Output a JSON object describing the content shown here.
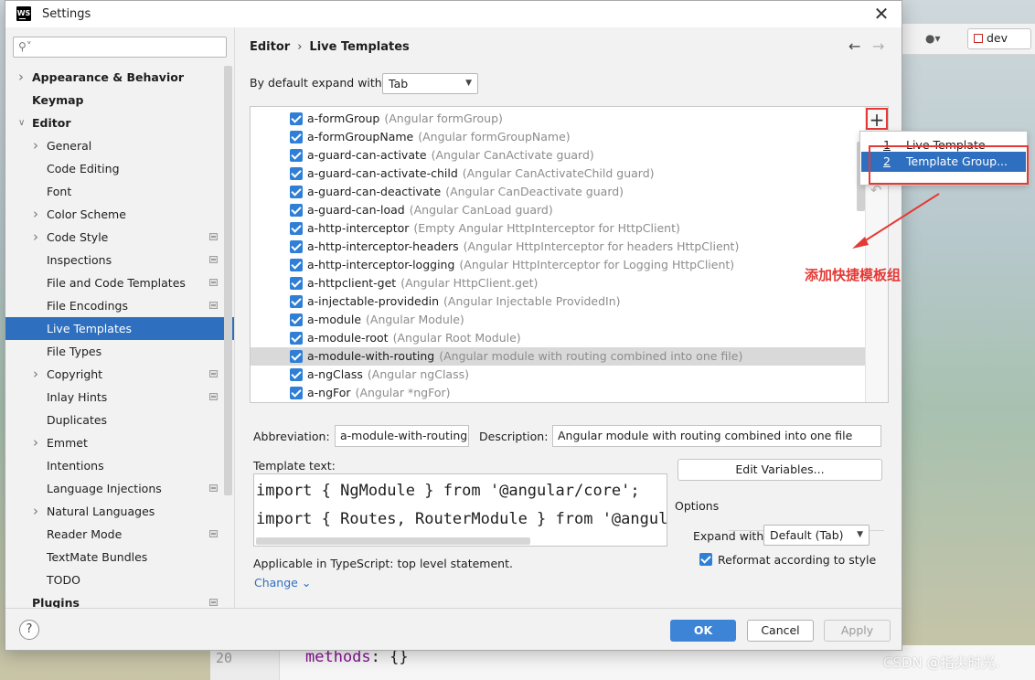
{
  "window": {
    "title": "Settings",
    "logo_text": "WS"
  },
  "background": {
    "user_icon": "user-icon",
    "branch": "dev",
    "line_number": "20",
    "code_key": "methods",
    "code_rest": ": {}",
    "watermark": "CSDN @指尖时光."
  },
  "sidebar": {
    "search_placeholder": "",
    "items": [
      {
        "label": "Appearance & Behavior",
        "level": 0,
        "arrow": "right",
        "bold": true
      },
      {
        "label": "Keymap",
        "level": 0,
        "arrow": "",
        "bold": true
      },
      {
        "label": "Editor",
        "level": 0,
        "arrow": "down",
        "bold": true
      },
      {
        "label": "General",
        "level": 1,
        "arrow": "right"
      },
      {
        "label": "Code Editing",
        "level": 1,
        "arrow": ""
      },
      {
        "label": "Font",
        "level": 1,
        "arrow": ""
      },
      {
        "label": "Color Scheme",
        "level": 1,
        "arrow": "right"
      },
      {
        "label": "Code Style",
        "level": 1,
        "arrow": "right",
        "project": true
      },
      {
        "label": "Inspections",
        "level": 1,
        "arrow": "",
        "project": true
      },
      {
        "label": "File and Code Templates",
        "level": 1,
        "arrow": "",
        "project": true
      },
      {
        "label": "File Encodings",
        "level": 1,
        "arrow": "",
        "project": true
      },
      {
        "label": "Live Templates",
        "level": 1,
        "arrow": "",
        "selected": true
      },
      {
        "label": "File Types",
        "level": 1,
        "arrow": ""
      },
      {
        "label": "Copyright",
        "level": 1,
        "arrow": "right",
        "project": true
      },
      {
        "label": "Inlay Hints",
        "level": 1,
        "arrow": "",
        "project": true
      },
      {
        "label": "Duplicates",
        "level": 1,
        "arrow": ""
      },
      {
        "label": "Emmet",
        "level": 1,
        "arrow": "right"
      },
      {
        "label": "Intentions",
        "level": 1,
        "arrow": ""
      },
      {
        "label": "Language Injections",
        "level": 1,
        "arrow": "",
        "project": true
      },
      {
        "label": "Natural Languages",
        "level": 1,
        "arrow": "right"
      },
      {
        "label": "Reader Mode",
        "level": 1,
        "arrow": "",
        "project": true
      },
      {
        "label": "TextMate Bundles",
        "level": 1,
        "arrow": ""
      },
      {
        "label": "TODO",
        "level": 1,
        "arrow": ""
      },
      {
        "label": "Plugins",
        "level": 0,
        "arrow": "",
        "bold": true,
        "project": true
      }
    ]
  },
  "breadcrumb": {
    "parent": "Editor",
    "separator": "›",
    "current": "Live Templates"
  },
  "expand": {
    "label": "By default expand with",
    "value": "Tab"
  },
  "templates": [
    {
      "name": "a-formGroup",
      "desc": "(Angular formGroup)"
    },
    {
      "name": "a-formGroupName",
      "desc": "(Angular formGroupName)"
    },
    {
      "name": "a-guard-can-activate",
      "desc": "(Angular CanActivate guard)"
    },
    {
      "name": "a-guard-can-activate-child",
      "desc": "(Angular CanActivateChild guard)"
    },
    {
      "name": "a-guard-can-deactivate",
      "desc": "(Angular CanDeactivate guard)"
    },
    {
      "name": "a-guard-can-load",
      "desc": "(Angular CanLoad guard)"
    },
    {
      "name": "a-http-interceptor",
      "desc": "(Empty Angular HttpInterceptor for HttpClient)"
    },
    {
      "name": "a-http-interceptor-headers",
      "desc": "(Angular HttpInterceptor for headers HttpClient)"
    },
    {
      "name": "a-http-interceptor-logging",
      "desc": "(Angular HttpInterceptor for Logging HttpClient)"
    },
    {
      "name": "a-httpclient-get",
      "desc": "(Angular HttpClient.get)"
    },
    {
      "name": "a-injectable-providedin",
      "desc": "(Angular Injectable ProvidedIn)"
    },
    {
      "name": "a-module",
      "desc": "(Angular Module)"
    },
    {
      "name": "a-module-root",
      "desc": "(Angular Root Module)"
    },
    {
      "name": "a-module-with-routing",
      "desc": "(Angular module with routing combined into one file)",
      "selected": true
    },
    {
      "name": "a-ngClass",
      "desc": "(Angular ngClass)"
    },
    {
      "name": "a-ngFor",
      "desc": "(Angular *ngFor)"
    }
  ],
  "add_menu": {
    "plus": "+",
    "items": [
      {
        "num": "1",
        "label": "Live Template"
      },
      {
        "num": "2",
        "label": "Template Group...",
        "highlighted": true
      }
    ]
  },
  "annotation": "添加快捷模板组",
  "form": {
    "abbreviation_label": "Abbreviation:",
    "abbreviation_value": "a-module-with-routing",
    "description_label": "Description:",
    "description_value": "Angular module with routing combined into one file",
    "template_text_label": "Template text:",
    "code_lines": [
      "import { NgModule } from '@angular/core';",
      "import { Routes, RouterModule } from '@angular/router';"
    ],
    "edit_variables": "Edit Variables...",
    "options_label": "Options",
    "expand_with_label": "Expand with",
    "expand_with_value": "Default (Tab)",
    "reformat_label": "Reformat according to style",
    "applicable": "Applicable in TypeScript: top level statement.",
    "change": "Change"
  },
  "footer": {
    "help": "?",
    "ok": "OK",
    "cancel": "Cancel",
    "apply": "Apply"
  },
  "colors": {
    "accent": "#2f6fbf",
    "annotation_red": "#e53935",
    "ok_button": "#3d84d6"
  }
}
